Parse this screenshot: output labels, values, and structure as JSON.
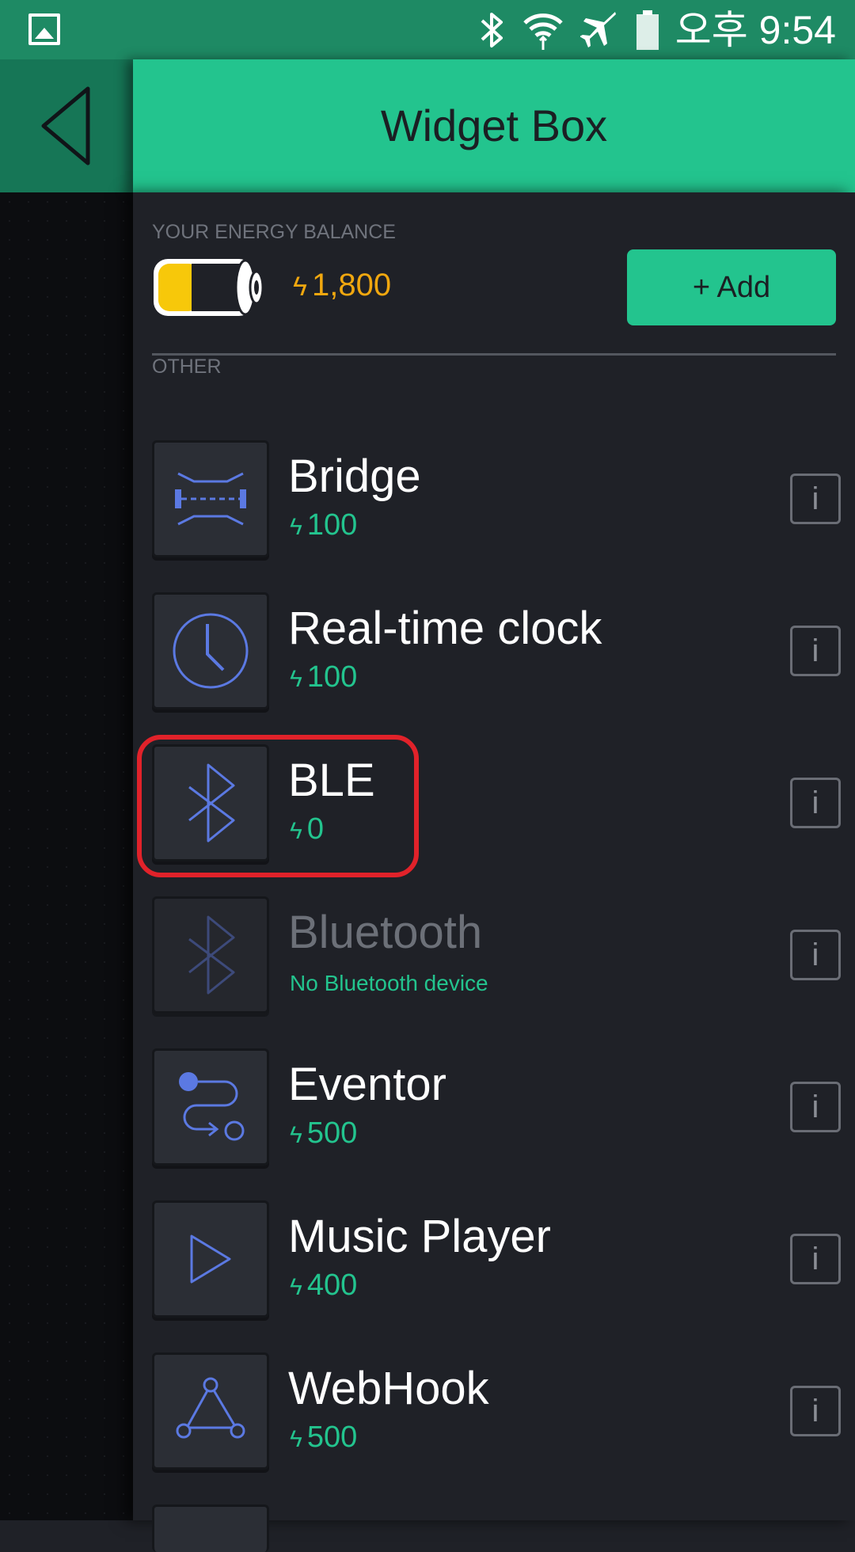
{
  "status_bar": {
    "time": "오후 9:54",
    "icons": [
      "gallery-icon",
      "bluetooth-icon",
      "wifi-icon",
      "airplane-icon",
      "battery-icon"
    ]
  },
  "header": {
    "title": "Widget Box",
    "back_icon": "back-arrow-icon"
  },
  "energy": {
    "label": "YOUR ENERGY BALANCE",
    "bolt": "ϟ",
    "value": "1,800",
    "add_label": "+ Add"
  },
  "section": {
    "label": "OTHER"
  },
  "items": [
    {
      "name": "Bridge",
      "bolt": "ϟ",
      "cost": "100",
      "icon": "bridge-icon",
      "info": "i"
    },
    {
      "name": "Real-time clock",
      "bolt": "ϟ",
      "cost": "100",
      "icon": "clock-icon",
      "info": "i"
    },
    {
      "name": "BLE",
      "bolt": "ϟ",
      "cost": "0",
      "icon": "bluetooth-icon",
      "info": "i"
    },
    {
      "name": "Bluetooth",
      "subtitle": "No Bluetooth device",
      "icon": "bluetooth-icon",
      "info": "i"
    },
    {
      "name": "Eventor",
      "bolt": "ϟ",
      "cost": "500",
      "icon": "eventor-icon",
      "info": "i"
    },
    {
      "name": "Music Player",
      "bolt": "ϟ",
      "cost": "400",
      "icon": "play-icon",
      "info": "i"
    },
    {
      "name": "WebHook",
      "bolt": "ϟ",
      "cost": "500",
      "icon": "webhook-icon",
      "info": "i"
    }
  ],
  "colors": {
    "accent": "#23c48e",
    "status_bar": "#1e8a64",
    "energy": "#f0a70f",
    "icon": "#5b79e2",
    "highlight": "#e1222a",
    "background": "#1f2127"
  }
}
